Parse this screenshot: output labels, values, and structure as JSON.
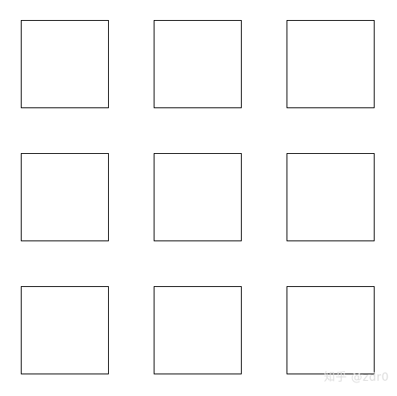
{
  "watermark": {
    "text": "知乎 @zdr0"
  },
  "grid": {
    "rows": 3,
    "cols": 3,
    "cell_count": 9
  }
}
